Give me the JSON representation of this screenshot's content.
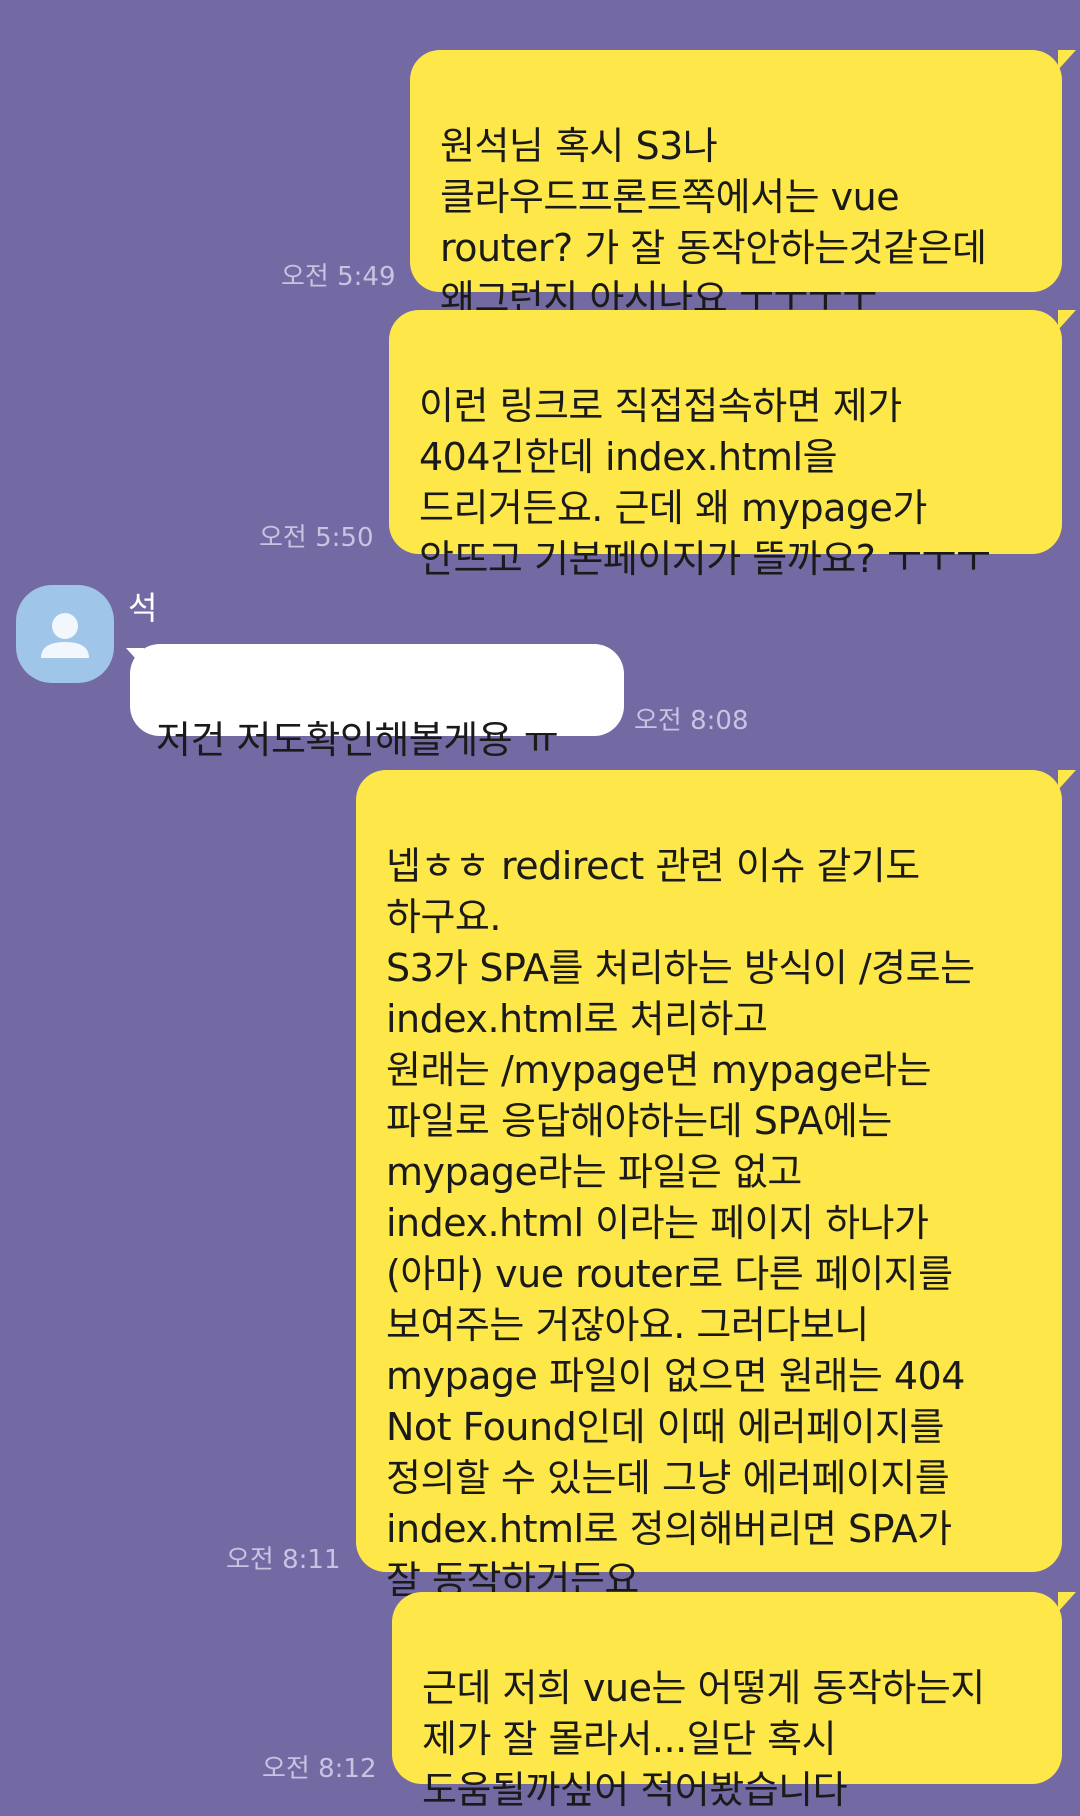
{
  "sender": {
    "name": "석",
    "avatar_icon": "person-silhouette-icon",
    "avatar_color": "#9fc5e8"
  },
  "colors": {
    "background": "#7369a3",
    "my_bubble": "#fee749",
    "other_bubble": "#ffffff",
    "timestamp": "#c9c3e2"
  },
  "messages": [
    {
      "from": "me",
      "text": "원석님 혹시 S3나\n클라우드프론트쪽에서는 vue\nrouter? 가 잘 동작안하는것같은데\n왜그런지 아시나요 ㅜㅜㅜㅜ",
      "time": "오전 5:49"
    },
    {
      "from": "me",
      "text": "이런 링크로 직접접속하면 제가\n404긴한데 index.html을\n드리거든요. 근데 왜 mypage가\n안뜨고 기본페이지가 뜰까요? ㅜㅜㅜ",
      "time": "오전 5:50"
    },
    {
      "from": "other",
      "text": "저건 저도확인해볼게용 ㅠ",
      "time": "오전 8:08"
    },
    {
      "from": "me",
      "text": "넵ㅎㅎ redirect 관련 이슈 같기도\n하구요.\nS3가 SPA를 처리하는 방식이 /경로는\nindex.html로 처리하고\n원래는 /mypage면 mypage라는\n파일로 응답해야하는데 SPA에는\nmypage라는 파일은 없고\nindex.html 이라는 페이지 하나가\n(아마) vue router로 다른 페이지를\n보여주는 거잖아요. 그러다보니\nmypage 파일이 없으면 원래는 404\nNot Found인데 이때 에러페이지를\n정의할 수 있는데 그냥 에러페이지를\nindex.html로 정의해버리면 SPA가\n잘 동작하거든요",
      "time": "오전 8:11"
    },
    {
      "from": "me",
      "text": "근데 저희 vue는 어떻게 동작하는지\n제가 잘 몰라서...일단 혹시\n도움될까싶어 적어봤습니다",
      "time": "오전 8:12"
    }
  ]
}
